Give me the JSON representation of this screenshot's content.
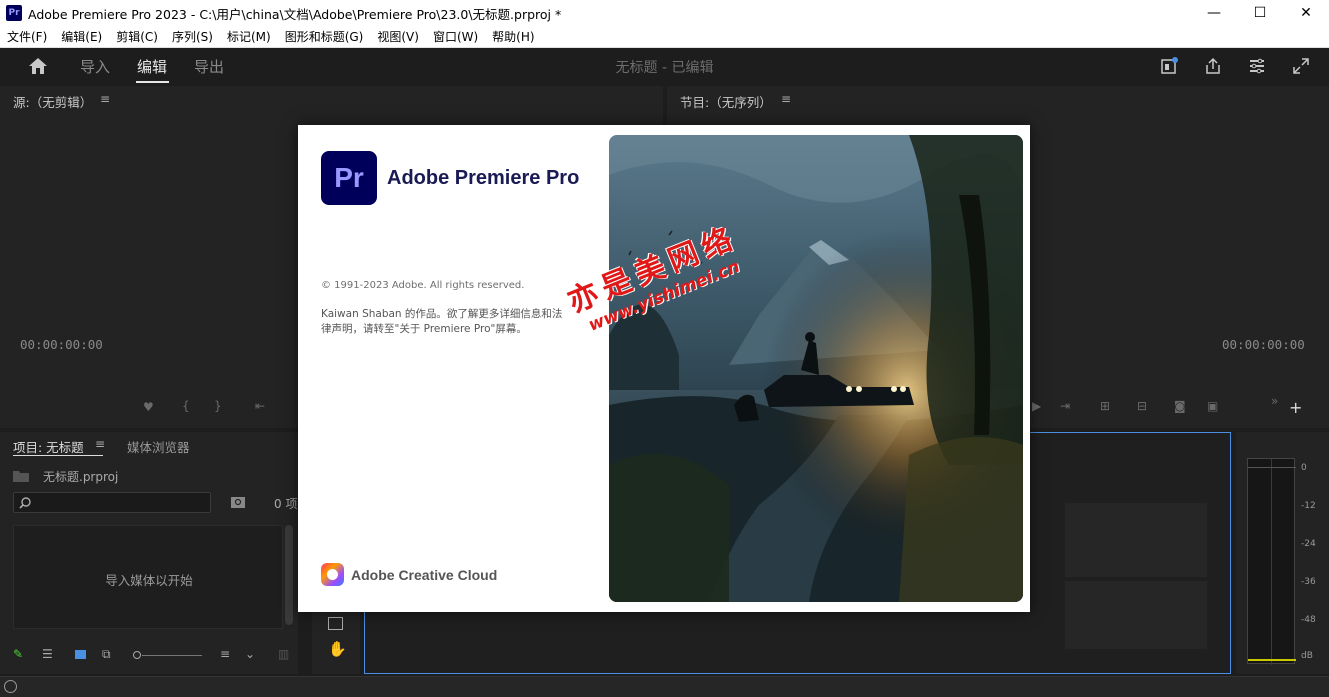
{
  "window": {
    "app_icon_label": "Pr",
    "title": "Adobe Premiere Pro 2023 - C:\\用户\\china\\文档\\Adobe\\Premiere Pro\\23.0\\无标题.prproj *",
    "minimize": "—",
    "maximize": "☐",
    "close": "✕"
  },
  "menu": [
    "文件(F)",
    "编辑(E)",
    "剪辑(C)",
    "序列(S)",
    "标记(M)",
    "图形和标题(G)",
    "视图(V)",
    "窗口(W)",
    "帮助(H)"
  ],
  "workspace": {
    "tabs": [
      "导入",
      "编辑",
      "导出"
    ],
    "active_tab": "编辑",
    "center_title": "无标题 - 已编辑"
  },
  "source_panel": {
    "title": "源:（无剪辑）",
    "timecode": "00:00:00:00"
  },
  "program_panel": {
    "title": "节目:（无序列）",
    "timecode": "00:00:00:00"
  },
  "project_panel": {
    "tab_project": "项目: 无标题",
    "tab_media_browser": "媒体浏览器",
    "project_file": "无标题.prproj",
    "item_count": "0 项",
    "empty_prompt": "导入媒体以开始"
  },
  "audio_meter": {
    "ticks": [
      "0",
      "-12",
      "-24",
      "-36",
      "-48",
      "dB"
    ]
  },
  "splash": {
    "logo": "Pr",
    "product_name": "Adobe Premiere Pro",
    "copyright": "© 1991-2023 Adobe. All rights reserved.",
    "credit": "Kaiwan Shaban 的作品。欲了解更多详细信息和法律声明，请转至\"关于 Premiere Pro\"屏幕。",
    "creative_cloud": "Adobe Creative Cloud"
  },
  "watermark": {
    "chinese": "亦是美网络",
    "url": "www.yishimei.cn"
  },
  "colors": {
    "accent_blue": "#4a90e2",
    "pr_dark": "#00005b",
    "pr_light": "#9999ff"
  }
}
